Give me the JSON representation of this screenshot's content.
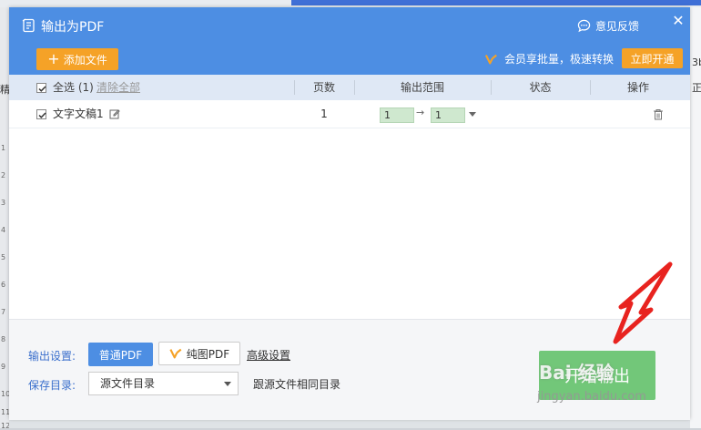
{
  "window": {
    "title": "输出为PDF",
    "feedback": "意见反馈",
    "close_glyph": "✕"
  },
  "toolbar": {
    "add_file": "添加文件",
    "vip_notice": "会员享批量，极速转换",
    "open_vip": "立即开通"
  },
  "table": {
    "select_all": "全选 (1)",
    "clear_all": "清除全部",
    "columns": {
      "pages": "页数",
      "range": "输出范围",
      "status": "状态",
      "action": "操作"
    },
    "rows": [
      {
        "name": "文字文稿1",
        "pages": "1",
        "range_from": "1",
        "range_to": "1",
        "range_arrow": "→",
        "status": ""
      }
    ]
  },
  "settings": {
    "output_label": "输出设置:",
    "normal_pdf": "普通PDF",
    "image_pdf": "纯图PDF",
    "advanced": "高级设置",
    "save_dir_label": "保存目录:",
    "save_dir_value": "源文件目录",
    "follow_dir": "跟源文件相同目录"
  },
  "actions": {
    "start": "开始输出"
  },
  "background": {
    "left_char": "精",
    "right_text_1": "3b",
    "right_text_2": "正",
    "ruler_ticks": [
      "1",
      "2",
      "3",
      "4",
      "5",
      "6",
      "7",
      "8",
      "9",
      "10",
      "11",
      "12"
    ]
  },
  "watermark": {
    "text": "Bai 经验",
    "url": "jingyan.baidu.com"
  },
  "colors": {
    "header": "#4d8ee3",
    "orange": "#f5a227",
    "start_button": "#67c46f",
    "annotation_arrow": "#e8231f",
    "link_label": "#3a6fcc"
  }
}
